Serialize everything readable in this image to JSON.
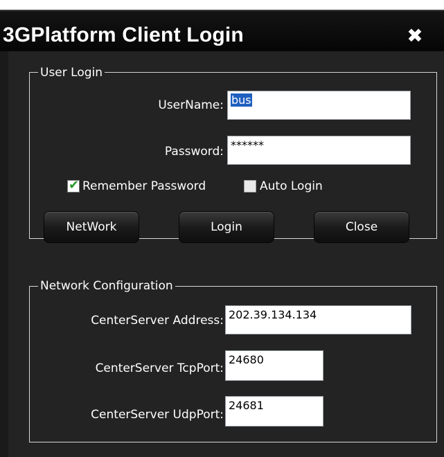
{
  "window": {
    "title": "3GPlatform Client Login",
    "close_glyph": "✖"
  },
  "user_login": {
    "legend": "User Login",
    "username_label": "UserName:",
    "username_value": "bus",
    "password_label": "Password:",
    "password_value": "******",
    "remember_label": "Remember Password",
    "remember_checked": true,
    "auto_label": "Auto Login",
    "auto_checked": false,
    "buttons": {
      "network": "NetWork",
      "login": "Login",
      "close": "Close"
    }
  },
  "network_config": {
    "legend": "Network Configuration",
    "address_label": "CenterServer Address:",
    "address_value": "202.39.134.134",
    "tcp_label": "CenterServer TcpPort:",
    "tcp_value": "24680",
    "udp_label": "CenterServer UdpPort:",
    "udp_value": "24681"
  },
  "colors": {
    "background": "#232323",
    "titlebar": "#0a0a0a",
    "check": "#2a9a2a",
    "selection": "#1f5fbf"
  }
}
